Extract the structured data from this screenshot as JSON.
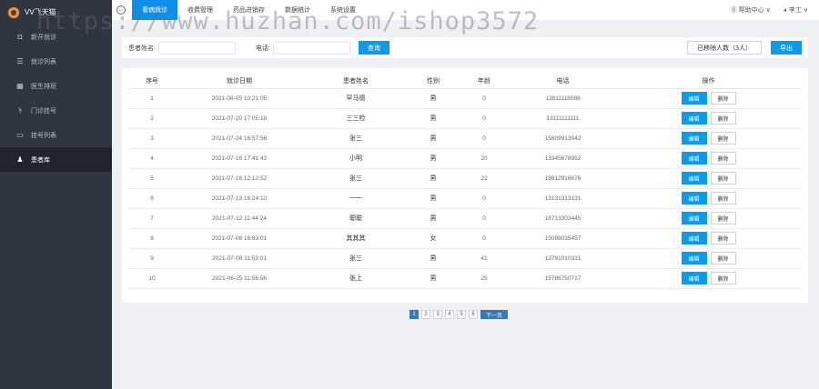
{
  "app": {
    "logo_text": "VV飞天猫"
  },
  "sidebar": {
    "items": [
      {
        "label": "新开就诊",
        "icon": "camera-icon",
        "glyph": "◘"
      },
      {
        "label": "就诊列表",
        "icon": "list-icon",
        "glyph": "☰"
      },
      {
        "label": "医生排班",
        "icon": "calendar-icon",
        "glyph": "▦"
      },
      {
        "label": "门诊挂号",
        "icon": "stethoscope-icon",
        "glyph": "⚕"
      },
      {
        "label": "挂号列表",
        "icon": "card-icon",
        "glyph": "▭"
      },
      {
        "label": "患者库",
        "icon": "user-icon",
        "glyph": "♟"
      }
    ],
    "active_index": 5
  },
  "topbar": {
    "back_glyph": "←",
    "tabs": [
      "看病就诊",
      "收费管理",
      "药品进销存",
      "数据统计",
      "系统设置"
    ],
    "active_tab": 0,
    "help": "帮助中心 ∨",
    "user": "李工 ∨"
  },
  "watermark": "https://www.huzhan.com/ishop3572",
  "search": {
    "name_label": "患者姓名:",
    "name_value": "",
    "phone_label": "电话:",
    "phone_value": "",
    "query_button": "查询",
    "removed_button": "已移除人数（3人）",
    "export_button": "导出"
  },
  "table": {
    "headers": [
      "序号",
      "就诊日期",
      "患者姓名",
      "性别",
      "年龄",
      "电话",
      "操作"
    ],
    "edit_label": "编辑",
    "delete_label": "删除",
    "rows": [
      [
        "1",
        "2021-08-05 10:21:05",
        "罕马德",
        "男",
        "0",
        "13811118088"
      ],
      [
        "2",
        "2021-07-20 17:05:18",
        "三三检",
        "男",
        "0",
        "13111111111"
      ],
      [
        "3",
        "2021-07-24 16:57:56",
        "张三",
        "男",
        "0",
        "15609913942"
      ],
      [
        "4",
        "2021-07-16 17:41:42",
        "小明",
        "男",
        "20",
        "13345678952"
      ],
      [
        "5",
        "2021-07-16 12:12:52",
        "张三",
        "男",
        "22",
        "18812916676"
      ],
      [
        "6",
        "2021-07-13 16:24:12",
        "一一",
        "男",
        "0",
        "13131313131"
      ],
      [
        "7",
        "2021-07-12 11:44:24",
        "聪聪",
        "男",
        "0",
        "18713303445"
      ],
      [
        "8",
        "2021-07-08 16:63:01",
        "其其其",
        "女",
        "0",
        "15098035457"
      ],
      [
        "9",
        "2021-07-08 11:53:01",
        "张三",
        "男",
        "41",
        "13791010331"
      ],
      [
        "10",
        "2021-06-25 11:56:56",
        "张上",
        "男",
        "25",
        "15786750717"
      ]
    ]
  },
  "pagination": {
    "pages": [
      "1",
      "2",
      "3",
      "4",
      "5",
      "6"
    ],
    "active": "1",
    "next": "下一页"
  }
}
